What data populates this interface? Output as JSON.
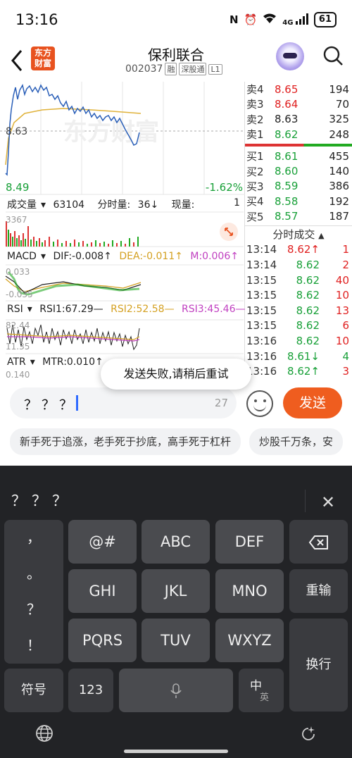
{
  "status": {
    "time": "13:16",
    "battery": "61",
    "signal": "4G"
  },
  "header": {
    "logo": [
      "东方",
      "财富"
    ],
    "title": "保利联合",
    "code": "002037",
    "tags": [
      "融",
      "深股通",
      "L1"
    ]
  },
  "chart": {
    "watermark": "东方财富",
    "ref_price": "8.63",
    "low_price": "8.49",
    "change_pct": "-1.62%",
    "volume": {
      "label": "成交量",
      "value": "63104",
      "tick_label": "分时量:",
      "tick_value": "36↓",
      "now_label": "现量:",
      "now_value": "1",
      "axis": "3367"
    },
    "macd": {
      "label": "MACD",
      "dif": "DIF:-0.008↑",
      "dea": "DEA:-0.011↑",
      "m": "M:0.006↑",
      "top": "0.033",
      "bottom": "-0.035"
    },
    "rsi": {
      "label": "RSI",
      "r1": "RSI1:67.29—",
      "r2": "RSI2:52.58—",
      "r3": "RSI3:45.46—",
      "top": "82.44",
      "bottom": "11.35"
    },
    "atr": {
      "label": "ATR",
      "mtr": "MTR:0.010↑",
      "axis": "0.140"
    }
  },
  "orderbook": {
    "sell": [
      {
        "label": "卖4",
        "price": "8.65",
        "vol": "194"
      },
      {
        "label": "卖3",
        "price": "8.64",
        "vol": "70"
      },
      {
        "label": "卖2",
        "price": "8.63",
        "vol": "325"
      },
      {
        "label": "卖1",
        "price": "8.62",
        "vol": "248"
      }
    ],
    "buy": [
      {
        "label": "买1",
        "price": "8.61",
        "vol": "455"
      },
      {
        "label": "买2",
        "price": "8.60",
        "vol": "140"
      },
      {
        "label": "买3",
        "price": "8.59",
        "vol": "386"
      },
      {
        "label": "买4",
        "price": "8.58",
        "vol": "192"
      },
      {
        "label": "买5",
        "price": "8.57",
        "vol": "187"
      }
    ],
    "trades_title": "分时成交",
    "trades": [
      {
        "time": "13:14",
        "price": "8.62↑",
        "vol": "1"
      },
      {
        "time": "13:14",
        "price": "8.62",
        "vol": "2"
      },
      {
        "time": "13:15",
        "price": "8.62",
        "vol": "40"
      },
      {
        "time": "13:15",
        "price": "8.62",
        "vol": "10"
      },
      {
        "time": "13:15",
        "price": "8.62",
        "vol": "13"
      },
      {
        "time": "13:15",
        "price": "8.62",
        "vol": "6"
      },
      {
        "time": "13:16",
        "price": "8.62",
        "vol": "10"
      },
      {
        "time": "13:16",
        "price": "8.61↓",
        "vol": "4"
      },
      {
        "time": "13:16",
        "price": "8.62↑",
        "vol": "3"
      }
    ]
  },
  "toast": "发送失败,请稍后重试",
  "composer": {
    "text": "？？？",
    "count": "27",
    "send": "发送",
    "chips": [
      "新手死于追涨，老手死于抄底，高手死于杠杆",
      "炒股千万条，安"
    ]
  },
  "keyboard": {
    "candidate": "？？？",
    "punct": [
      "，",
      "。",
      "？",
      "！"
    ],
    "row1": [
      "@#",
      "ABC",
      "DEF"
    ],
    "row2": [
      "GHI",
      "JKL",
      "MNO"
    ],
    "row3": [
      "PQRS",
      "TUV",
      "WXYZ"
    ],
    "reinput": "重输",
    "newline": "换行",
    "symbols": "符号",
    "num": "123",
    "lang_top": "中",
    "lang_bottom": "英"
  }
}
